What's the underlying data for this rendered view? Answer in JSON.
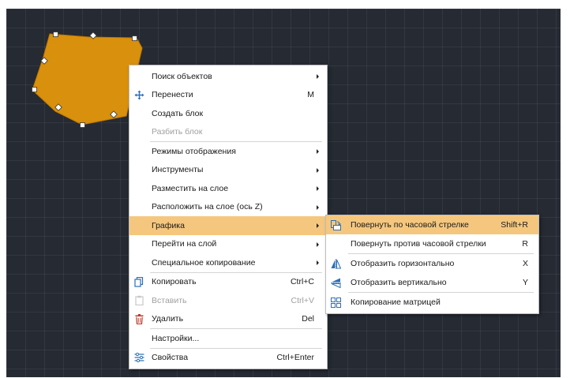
{
  "colors": {
    "canvas": "#262a33",
    "shape_fill": "#d9900c",
    "highlight": "#f5c77e",
    "menu_bg": "#ffffff",
    "disabled": "#a0a0a0",
    "icon_blue": "#2b6fb7",
    "icon_red": "#c0392b"
  },
  "context_menu": {
    "items": [
      {
        "label": "Поиск объектов",
        "submenu": true
      },
      {
        "label": "Перенести",
        "shortcut": "M",
        "icon": "move-icon"
      },
      {
        "label": "Создать блок"
      },
      {
        "label": "Разбить блок",
        "disabled": true
      },
      {
        "label": "Режимы отображения",
        "submenu": true
      },
      {
        "label": "Инструменты",
        "submenu": true
      },
      {
        "label": "Разместить на слое",
        "submenu": true
      },
      {
        "label": "Расположить на слое (ось Z)",
        "submenu": true
      },
      {
        "label": "Графика",
        "submenu": true,
        "highlighted": true
      },
      {
        "label": "Перейти на слой",
        "submenu": true
      },
      {
        "label": "Специальное копирование",
        "submenu": true
      },
      {
        "label": "Копировать",
        "shortcut": "Ctrl+C",
        "icon": "copy-icon"
      },
      {
        "label": "Вставить",
        "shortcut": "Ctrl+V",
        "icon": "paste-icon",
        "disabled": true
      },
      {
        "label": "Удалить",
        "shortcut": "Del",
        "icon": "trash-icon"
      },
      {
        "label": "Настройки..."
      },
      {
        "label": "Свойства",
        "shortcut": "Ctrl+Enter",
        "icon": "properties-icon"
      }
    ]
  },
  "graphics_submenu": {
    "items": [
      {
        "label": "Повернуть по часовой стрелке",
        "shortcut": "Shift+R",
        "icon": "rotate-cw-icon",
        "highlighted": true
      },
      {
        "label": "Повернуть против часовой стрелки",
        "shortcut": "R"
      },
      {
        "label": "Отобразить горизонтально",
        "shortcut": "X",
        "icon": "flip-horizontal-icon"
      },
      {
        "label": "Отобразить вертикально",
        "shortcut": "Y",
        "icon": "flip-vertical-icon"
      },
      {
        "label": "Копирование матрицей",
        "icon": "matrix-copy-icon"
      }
    ]
  }
}
